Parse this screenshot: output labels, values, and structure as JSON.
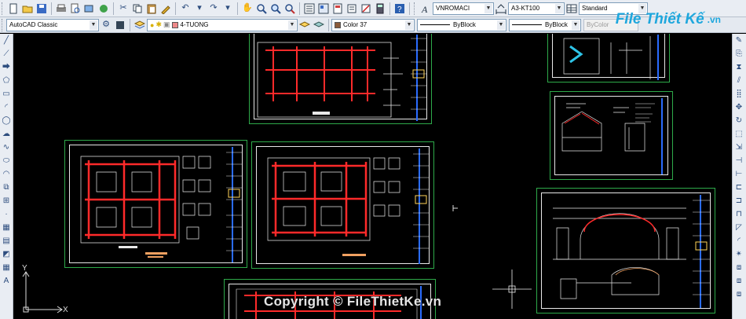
{
  "toolbar1": {
    "text_style": "VNROMACI",
    "dim_style": "A3-KT100",
    "table_style": "Standard"
  },
  "toolbar2": {
    "workspace": "AutoCAD Classic",
    "layer": "4-TUONG",
    "color": "Color 37",
    "linetype": "ByBlock",
    "lineweight": "ByBlock",
    "plotstyle": "ByColor"
  },
  "canvas": {
    "watermark": "Copyright © FileThietKe.vn",
    "logo_text": "File Thiết Kế",
    "logo_suffix": ".vn",
    "ucs_x": "X",
    "ucs_y": "Y"
  },
  "colors": {
    "sheet_border": "#2eaa4a",
    "grid_red": "#ff2a2a",
    "annotation_white": "#e8e8e8",
    "titleblock_blue": "#2a6cff",
    "logo_blue": "#1ea7dd"
  }
}
